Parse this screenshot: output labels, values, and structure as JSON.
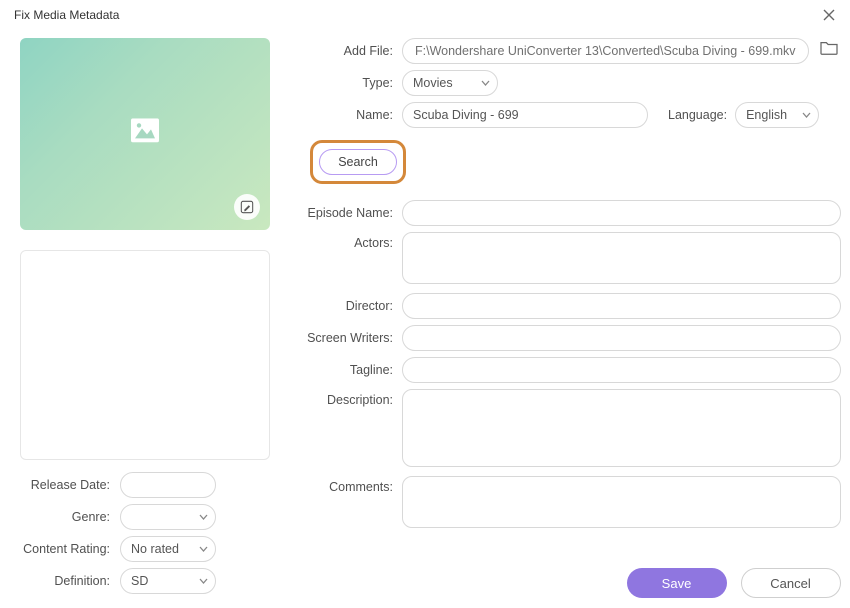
{
  "window": {
    "title": "Fix Media Metadata"
  },
  "file": {
    "label": "Add File:",
    "path": "F:\\Wondershare UniConverter 13\\Converted\\Scuba Diving - 699.mkv"
  },
  "type": {
    "label": "Type:",
    "value": "Movies"
  },
  "name": {
    "label": "Name:",
    "value": "Scuba Diving - 699"
  },
  "language": {
    "label": "Language:",
    "value": "English"
  },
  "search_btn": "Search",
  "episode": {
    "label": "Episode Name:",
    "value": ""
  },
  "actors": {
    "label": "Actors:",
    "value": ""
  },
  "director": {
    "label": "Director:",
    "value": ""
  },
  "writers": {
    "label": "Screen Writers:",
    "value": ""
  },
  "tagline": {
    "label": "Tagline:",
    "value": ""
  },
  "description": {
    "label": "Description:",
    "value": ""
  },
  "comments": {
    "label": "Comments:",
    "value": ""
  },
  "left": {
    "release": {
      "label": "Release Date:",
      "value": ""
    },
    "genre": {
      "label": "Genre:",
      "value": ""
    },
    "rating": {
      "label": "Content Rating:",
      "value": "No rated"
    },
    "definition": {
      "label": "Definition:",
      "value": "SD"
    }
  },
  "footer": {
    "save": "Save",
    "cancel": "Cancel"
  }
}
